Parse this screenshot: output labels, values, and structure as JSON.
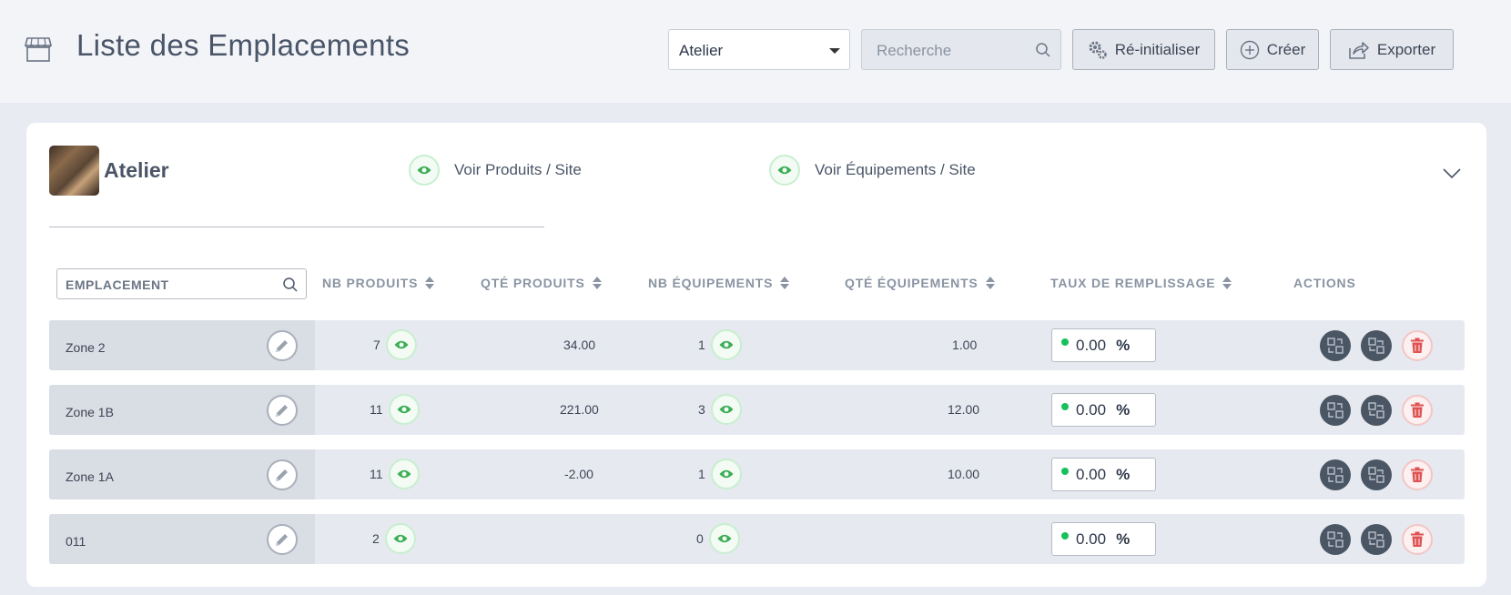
{
  "header": {
    "title": "Liste des Emplacements",
    "page_icon": "store-icon",
    "site_select": {
      "value": "Atelier"
    },
    "search": {
      "placeholder": "Recherche"
    },
    "buttons": {
      "reset": "Ré-initialiser",
      "create": "Créer",
      "export": "Exporter"
    }
  },
  "site": {
    "name": "Atelier",
    "view_products": "Voir Produits / Site",
    "view_equipment": "Voir Équipements / Site"
  },
  "table": {
    "filter_placeholder": "EMPLACEMENT",
    "columns": {
      "nb_products": "NB PRODUITS",
      "qty_products": "QTÉ PRODUITS",
      "nb_equipment": "NB ÉQUIPEMENTS",
      "qty_equipment": "QTÉ ÉQUIPEMENTS",
      "fill_rate": "TAUX DE REMPLISSAGE",
      "actions": "ACTIONS"
    },
    "percent_sign": "%",
    "rows": [
      {
        "name": "Zone 2",
        "nb_products": "7",
        "qty_products": "34.00",
        "nb_equipment": "1",
        "qty_equipment": "1.00",
        "fill_rate": "0.00"
      },
      {
        "name": "Zone 1B",
        "nb_products": "11",
        "qty_products": "221.00",
        "nb_equipment": "3",
        "qty_equipment": "12.00",
        "fill_rate": "0.00"
      },
      {
        "name": "Zone 1A",
        "nb_products": "11",
        "qty_products": "-2.00",
        "nb_equipment": "1",
        "qty_equipment": "10.00",
        "fill_rate": "0.00"
      },
      {
        "name": "011",
        "nb_products": "2",
        "qty_products": "",
        "nb_equipment": "0",
        "qty_equipment": "",
        "fill_rate": "0.00"
      }
    ]
  },
  "colors": {
    "accent_green": "#16c15b",
    "eye_green": "#3cae55",
    "delete_red": "#e05252",
    "action_dark": "#4b5665"
  }
}
